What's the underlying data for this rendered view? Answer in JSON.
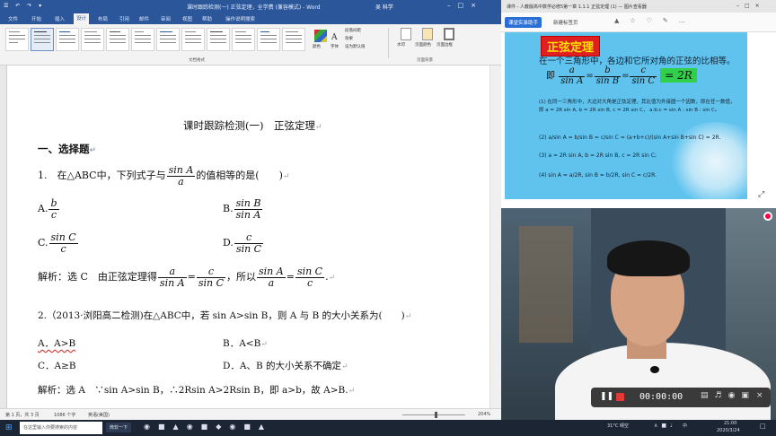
{
  "word": {
    "quick_access": "☰ ↶ ↷ ▾",
    "title": "课时跟踪检测(一) 正弦定理，全学费 (兼容模式) - Word",
    "user": "吴 科学",
    "tabs": [
      "文件",
      "开始",
      "插入",
      "设计",
      "布局",
      "引用",
      "邮件",
      "审阅",
      "视图",
      "帮助",
      "操作说明搜索"
    ],
    "ribbon": {
      "group_label": "文档格式",
      "page_bg_label": "页面背景",
      "colors": "颜色",
      "fonts": "字体",
      "para_spacing": "段落间距",
      "effects": "效果",
      "set_default": "设为默认值",
      "watermark": "水印",
      "page_color": "页面颜色",
      "page_border": "页面边框"
    },
    "status": {
      "page": "第 1 页，共 3 页",
      "words": "1086 个字",
      "lang": "英语(美国)",
      "zoom": "204%"
    }
  },
  "doc": {
    "title": "课时跟踪检测(一)　正弦定理",
    "section": "一、选择题",
    "q1_pre": "1.　在△ABC中，下列式子与",
    "q1_frac_num": "sin A",
    "q1_frac_den": "a",
    "q1_post": "的值相等的是(　　)",
    "optA_label": "A.",
    "optA_num": "b",
    "optA_den": "c",
    "optB_label": "B.",
    "optB_num": "sin B",
    "optB_den": "sin A",
    "optC_label": "C.",
    "optC_num": "sin C",
    "optC_den": "c",
    "optD_label": "D.",
    "optD_num": "c",
    "optD_den": "sin C",
    "ans1_pre": "解析：选 C　由正弦定理得",
    "ans1_f1_num": "a",
    "ans1_f1_den": "sin A",
    "ans1_eq": "=",
    "ans1_f2_num": "c",
    "ans1_f2_den": "sin C",
    "ans1_mid": "，所以",
    "ans1_f3_num": "sin A",
    "ans1_f3_den": "a",
    "ans1_f4_num": "sin C",
    "ans1_f4_den": "c",
    "ans1_end": ".",
    "q2": "2.（2013·浏阳高二检测)在△ABC中，若 sin A>sin B，则 A 与 B 的大小关系为(　　)",
    "q2_A": "A．A>B",
    "q2_B": "B．A<B",
    "q2_C": "C．A≥B",
    "q2_D": "D．A、B 的大小关系不确定",
    "ans2": "解析：选 A　∵sin A>sin B，∴2Rsin A>2Rsin B，即 a>b，故 A>B."
  },
  "browser": {
    "title": "课件 - 人教版高中数学必修5第一章 1.1.1 正弦定理 (1) — 图片查看器",
    "tab": "课堂实录助手",
    "new_tab": "新建标签页",
    "slide": {
      "heading": "正弦定理",
      "line1": "在一个三角形中，各边和它所对角的正弦的比相等。",
      "formula_prefix": "即",
      "f1_num": "a",
      "f1_den": "sin A",
      "f2_num": "b",
      "f2_den": "sin B",
      "f3_num": "c",
      "f3_den": "sin C",
      "eq": "=",
      "box": "= 2R",
      "p1": "(1) 在同一三角形中，大边对大角是正弦定理，其比值为外接圆一个因数，即在任一数值，即 a = 2R sin A, b = 2R sin B, c = 2R sin C， a:b:c = sin A : sin B : sin C。",
      "p2": "(2) a/sin A = b/sin B = c/sin C = (a+b+c)/(sin A+sin B+sin C) = 2R.",
      "p3": "(3) a = 2R sin A, b = 2R sin B, c = 2R sin C;",
      "p4": "(4) sin A = a/2R, sin B = b/2R, sin C = c/2R."
    }
  },
  "player": {
    "time": "00:00:00"
  },
  "taskbar": {
    "search_placeholder": "在这里输入你要搜索的内容",
    "search_short": "搜索",
    "app1": "微软一下",
    "weather": "31°C 晴空",
    "clock_time": "21:00",
    "clock_date": "2020/3/24",
    "ime": "中"
  },
  "colors": {
    "word_blue": "#2b579a",
    "slide_bg": "#5fc3ee",
    "slide_heading_bg": "#e02020",
    "slide_box_bg": "#32d04a",
    "record_red": "#e53935"
  }
}
